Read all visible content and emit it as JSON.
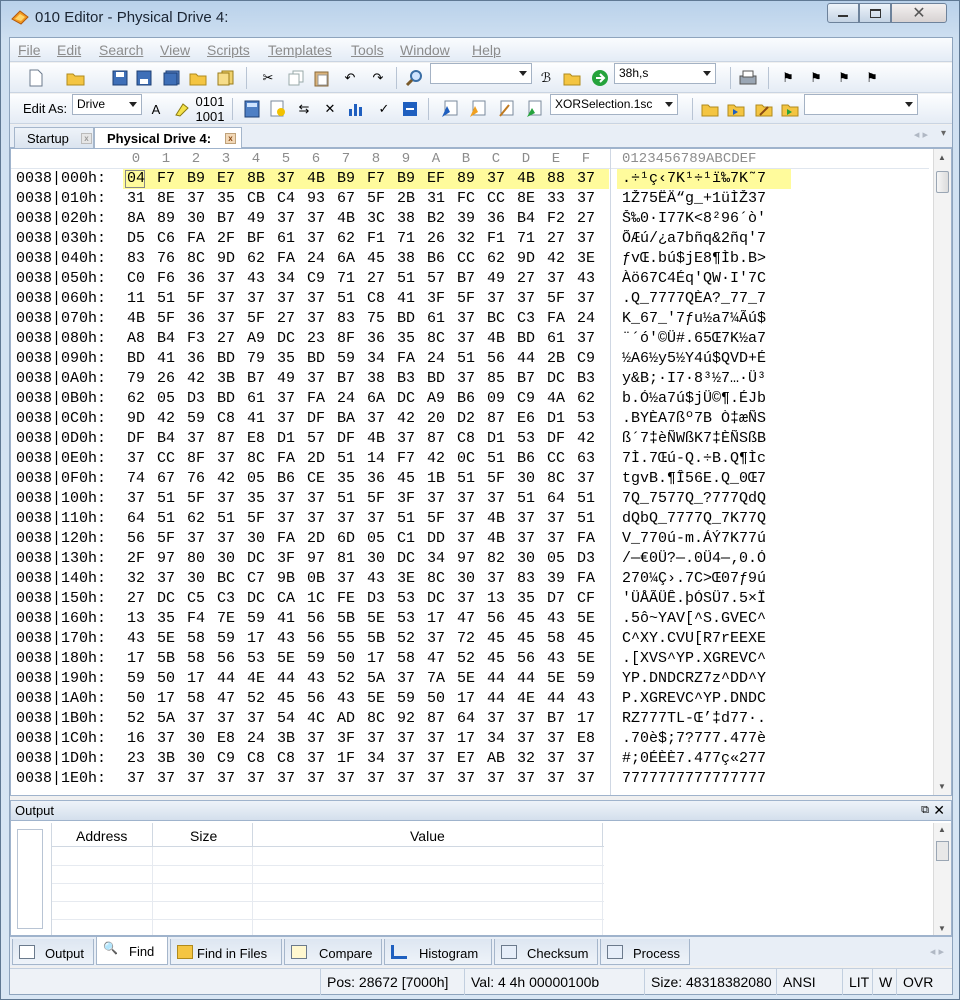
{
  "window": {
    "title": "010 Editor - Physical Drive 4:"
  },
  "menu": [
    "File",
    "Edit",
    "Search",
    "View",
    "Scripts",
    "Templates",
    "Tools",
    "Window",
    "Help"
  ],
  "toolbar": {
    "goto_value": "38h,s",
    "edit_as_label": "Edit As:",
    "edit_as_value": "Drive",
    "script_value": "XORSelection.1sc"
  },
  "tabs": {
    "startup": "Startup",
    "active": "Physical Drive 4:"
  },
  "hex_header": {
    "columns": [
      "0",
      "1",
      "2",
      "3",
      "4",
      "5",
      "6",
      "7",
      "8",
      "9",
      "A",
      "B",
      "C",
      "D",
      "E",
      "F"
    ],
    "ascii": "0123456789ABCDEF"
  },
  "rows": [
    {
      "addr": "0038|000h:",
      "bytes": [
        "04",
        "F7",
        "B9",
        "E7",
        "8B",
        "37",
        "4B",
        "B9",
        "F7",
        "B9",
        "EF",
        "89",
        "37",
        "4B",
        "88",
        "37"
      ],
      "ascii": ".÷¹ç‹7K¹÷¹ï‰7K˜7"
    },
    {
      "addr": "0038|010h:",
      "bytes": [
        "31",
        "8E",
        "37",
        "35",
        "CB",
        "C4",
        "93",
        "67",
        "5F",
        "2B",
        "31",
        "FC",
        "CC",
        "8E",
        "33",
        "37"
      ],
      "ascii": "1Ž75ËÄ“g_+1üÌŽ37"
    },
    {
      "addr": "0038|020h:",
      "bytes": [
        "8A",
        "89",
        "30",
        "B7",
        "49",
        "37",
        "37",
        "4B",
        "3C",
        "38",
        "B2",
        "39",
        "36",
        "B4",
        "F2",
        "27"
      ],
      "ascii": "Š‰0·I77K<8²96´ò'"
    },
    {
      "addr": "0038|030h:",
      "bytes": [
        "D5",
        "C6",
        "FA",
        "2F",
        "BF",
        "61",
        "37",
        "62",
        "F1",
        "71",
        "26",
        "32",
        "F1",
        "71",
        "27",
        "37"
      ],
      "ascii": "ÕÆú/¿a7bñq&2ñq'7"
    },
    {
      "addr": "0038|040h:",
      "bytes": [
        "83",
        "76",
        "8C",
        "9D",
        "62",
        "FA",
        "24",
        "6A",
        "45",
        "38",
        "B6",
        "CC",
        "62",
        "9D",
        "42",
        "3E"
      ],
      "ascii": "ƒvŒ.bú$jE8¶Ìb.B>"
    },
    {
      "addr": "0038|050h:",
      "bytes": [
        "C0",
        "F6",
        "36",
        "37",
        "43",
        "34",
        "C9",
        "71",
        "27",
        "51",
        "57",
        "B7",
        "49",
        "27",
        "37",
        "43"
      ],
      "ascii": "Àö67C4Éq'QW·I'7C"
    },
    {
      "addr": "0038|060h:",
      "bytes": [
        "11",
        "51",
        "5F",
        "37",
        "37",
        "37",
        "37",
        "51",
        "C8",
        "41",
        "3F",
        "5F",
        "37",
        "37",
        "5F",
        "37"
      ],
      "ascii": ".Q_7777QÈA?_77_7"
    },
    {
      "addr": "0038|070h:",
      "bytes": [
        "4B",
        "5F",
        "36",
        "37",
        "5F",
        "27",
        "37",
        "83",
        "75",
        "BD",
        "61",
        "37",
        "BC",
        "C3",
        "FA",
        "24"
      ],
      "ascii": "K_67_'7ƒu½a7¼Ãú$"
    },
    {
      "addr": "0038|080h:",
      "bytes": [
        "A8",
        "B4",
        "F3",
        "27",
        "A9",
        "DC",
        "23",
        "8F",
        "36",
        "35",
        "8C",
        "37",
        "4B",
        "BD",
        "61",
        "37"
      ],
      "ascii": "¨´ó'©Ü#.65Œ7K½a7"
    },
    {
      "addr": "0038|090h:",
      "bytes": [
        "BD",
        "41",
        "36",
        "BD",
        "79",
        "35",
        "BD",
        "59",
        "34",
        "FA",
        "24",
        "51",
        "56",
        "44",
        "2B",
        "C9"
      ],
      "ascii": "½A6½y5½Y4ú$QVD+É"
    },
    {
      "addr": "0038|0A0h:",
      "bytes": [
        "79",
        "26",
        "42",
        "3B",
        "B7",
        "49",
        "37",
        "B7",
        "38",
        "B3",
        "BD",
        "37",
        "85",
        "B7",
        "DC",
        "B3"
      ],
      "ascii": "y&B;·I7·8³½7…·Ü³"
    },
    {
      "addr": "0038|0B0h:",
      "bytes": [
        "62",
        "05",
        "D3",
        "BD",
        "61",
        "37",
        "FA",
        "24",
        "6A",
        "DC",
        "A9",
        "B6",
        "09",
        "C9",
        "4A",
        "62"
      ],
      "ascii": "b.Ó½a7ú$jÜ©¶.ÉJb"
    },
    {
      "addr": "0038|0C0h:",
      "bytes": [
        "9D",
        "42",
        "59",
        "C8",
        "41",
        "37",
        "DF",
        "BA",
        "37",
        "42",
        "20",
        "D2",
        "87",
        "E6",
        "D1",
        "53"
      ],
      "ascii": ".BYÈA7ßº7B Ò‡æÑS"
    },
    {
      "addr": "0038|0D0h:",
      "bytes": [
        "DF",
        "B4",
        "37",
        "87",
        "E8",
        "D1",
        "57",
        "DF",
        "4B",
        "37",
        "87",
        "C8",
        "D1",
        "53",
        "DF",
        "42"
      ],
      "ascii": "ß´7‡èÑWßK7‡ÈÑSßB"
    },
    {
      "addr": "0038|0E0h:",
      "bytes": [
        "37",
        "CC",
        "8F",
        "37",
        "8C",
        "FA",
        "2D",
        "51",
        "14",
        "F7",
        "42",
        "0C",
        "51",
        "B6",
        "CC",
        "63"
      ],
      "ascii": "7Ì.7Œú-Q.÷B.Q¶Ìc"
    },
    {
      "addr": "0038|0F0h:",
      "bytes": [
        "74",
        "67",
        "76",
        "42",
        "05",
        "B6",
        "CE",
        "35",
        "36",
        "45",
        "1B",
        "51",
        "5F",
        "30",
        "8C",
        "37"
      ],
      "ascii": "tgvB.¶Î56E.Q_0Œ7"
    },
    {
      "addr": "0038|100h:",
      "bytes": [
        "37",
        "51",
        "5F",
        "37",
        "35",
        "37",
        "37",
        "51",
        "5F",
        "3F",
        "37",
        "37",
        "37",
        "51",
        "64",
        "51"
      ],
      "ascii": "7Q_7577Q_?777QdQ"
    },
    {
      "addr": "0038|110h:",
      "bytes": [
        "64",
        "51",
        "62",
        "51",
        "5F",
        "37",
        "37",
        "37",
        "37",
        "51",
        "5F",
        "37",
        "4B",
        "37",
        "37",
        "51"
      ],
      "ascii": "dQbQ_7777Q_7K77Q"
    },
    {
      "addr": "0038|120h:",
      "bytes": [
        "56",
        "5F",
        "37",
        "37",
        "30",
        "FA",
        "2D",
        "6D",
        "05",
        "C1",
        "DD",
        "37",
        "4B",
        "37",
        "37",
        "FA"
      ],
      "ascii": "V_770ú-m.ÁÝ7K77ú"
    },
    {
      "addr": "0038|130h:",
      "bytes": [
        "2F",
        "97",
        "80",
        "30",
        "DC",
        "3F",
        "97",
        "81",
        "30",
        "DC",
        "34",
        "97",
        "82",
        "30",
        "05",
        "D3"
      ],
      "ascii": "/—€0Ü?—.0Ü4—‚0.Ó"
    },
    {
      "addr": "0038|140h:",
      "bytes": [
        "32",
        "37",
        "30",
        "BC",
        "C7",
        "9B",
        "0B",
        "37",
        "43",
        "3E",
        "8C",
        "30",
        "37",
        "83",
        "39",
        "FA"
      ],
      "ascii": "270¼Ç›.7C>Œ07ƒ9ú"
    },
    {
      "addr": "0038|150h:",
      "bytes": [
        "27",
        "DC",
        "C5",
        "C3",
        "DC",
        "CA",
        "1C",
        "FE",
        "D3",
        "53",
        "DC",
        "37",
        "13",
        "35",
        "D7",
        "CF"
      ],
      "ascii": "'ÜÅÃÜÊ.þÓSÜ7.5×Ï"
    },
    {
      "addr": "0038|160h:",
      "bytes": [
        "13",
        "35",
        "F4",
        "7E",
        "59",
        "41",
        "56",
        "5B",
        "5E",
        "53",
        "17",
        "47",
        "56",
        "45",
        "43",
        "5E"
      ],
      "ascii": ".5ô~YAV[^S.GVEC^"
    },
    {
      "addr": "0038|170h:",
      "bytes": [
        "43",
        "5E",
        "58",
        "59",
        "17",
        "43",
        "56",
        "55",
        "5B",
        "52",
        "37",
        "72",
        "45",
        "45",
        "58",
        "45"
      ],
      "ascii": "C^XY.CVU[R7rEEXE"
    },
    {
      "addr": "0038|180h:",
      "bytes": [
        "17",
        "5B",
        "58",
        "56",
        "53",
        "5E",
        "59",
        "50",
        "17",
        "58",
        "47",
        "52",
        "45",
        "56",
        "43",
        "5E"
      ],
      "ascii": ".[XVS^YP.XGREVC^"
    },
    {
      "addr": "0038|190h:",
      "bytes": [
        "59",
        "50",
        "17",
        "44",
        "4E",
        "44",
        "43",
        "52",
        "5A",
        "37",
        "7A",
        "5E",
        "44",
        "44",
        "5E",
        "59"
      ],
      "ascii": "YP.DNDCRZ7z^DD^Y"
    },
    {
      "addr": "0038|1A0h:",
      "bytes": [
        "50",
        "17",
        "58",
        "47",
        "52",
        "45",
        "56",
        "43",
        "5E",
        "59",
        "50",
        "17",
        "44",
        "4E",
        "44",
        "43"
      ],
      "ascii": "P.XGREVC^YP.DNDC"
    },
    {
      "addr": "0038|1B0h:",
      "bytes": [
        "52",
        "5A",
        "37",
        "37",
        "37",
        "54",
        "4C",
        "AD",
        "8C",
        "92",
        "87",
        "64",
        "37",
        "37",
        "B7",
        "17"
      ],
      "ascii": "RZ777TL-Œ’‡d77·."
    },
    {
      "addr": "0038|1C0h:",
      "bytes": [
        "16",
        "37",
        "30",
        "E8",
        "24",
        "3B",
        "37",
        "3F",
        "37",
        "37",
        "37",
        "17",
        "34",
        "37",
        "37",
        "E8"
      ],
      "ascii": ".70è$;7?777.477è"
    },
    {
      "addr": "0038|1D0h:",
      "bytes": [
        "23",
        "3B",
        "30",
        "C9",
        "C8",
        "C8",
        "37",
        "1F",
        "34",
        "37",
        "37",
        "E7",
        "AB",
        "32",
        "37",
        "37"
      ],
      "ascii": "#;0ÉÈÈ7.477ç«277"
    },
    {
      "addr": "0038|1E0h:",
      "bytes": [
        "37",
        "37",
        "37",
        "37",
        "37",
        "37",
        "37",
        "37",
        "37",
        "37",
        "37",
        "37",
        "37",
        "37",
        "37",
        "37"
      ],
      "ascii": "7777777777777777"
    }
  ],
  "output": {
    "title": "Output",
    "columns": [
      "Address",
      "Size",
      "Value"
    ]
  },
  "bottom_tabs": [
    "Output",
    "Find",
    "Find in Files",
    "Compare",
    "Histogram",
    "Checksum",
    "Process"
  ],
  "status": {
    "pos": "Pos: 28672 [7000h]",
    "val": "Val: 4 4h 00000100b",
    "size": "Size: 48318382080",
    "encoding": "ANSI",
    "lit": "LIT",
    "w": "W",
    "ovr": "OVR"
  },
  "colors": {
    "selection": "#fffb9c",
    "window_frame": "#b9d1ea",
    "accent_blue": "#1f5fbf"
  }
}
